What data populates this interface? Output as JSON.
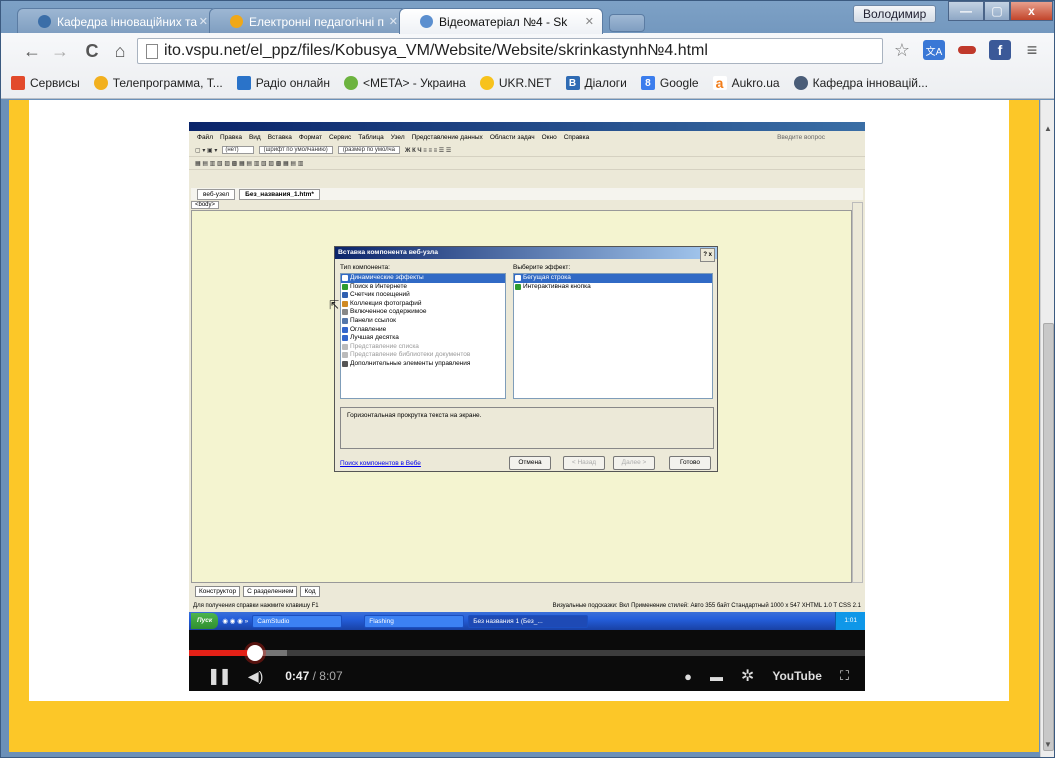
{
  "window": {
    "user_label": "Володимир",
    "minimize_glyph": "—",
    "maximize_glyph": "▢",
    "close_glyph": "x"
  },
  "tabs": [
    {
      "label": "Кафедра інноваційних та",
      "icon": "globe-icon",
      "active": false
    },
    {
      "label": "Електронні педагогічні п",
      "icon": "globe-icon",
      "active": false
    },
    {
      "label": "Відеоматеріал №4 - Sk",
      "icon": "video-icon",
      "active": true
    }
  ],
  "toolbar": {
    "url": "ito.vspu.net/el_ppz/files/Kobusya_VM/Website/Website/skrinkastynh№4.html",
    "back_glyph": "←",
    "forward_glyph": "→",
    "reload_glyph": "C",
    "home_glyph": "⌂",
    "star_glyph": "☆",
    "menu_glyph": "≡"
  },
  "bookmarks": [
    {
      "label": "Сервисы",
      "color": "#e24a2b"
    },
    {
      "label": "Телепрограмма, Т...",
      "color": "#f2b01e"
    },
    {
      "label": "Радіо онлайн",
      "color": "#2a73c9"
    },
    {
      "label": "<META> - Украина",
      "color": "#6cb33f"
    },
    {
      "label": "UKR.NET",
      "color": "#f7c21c"
    },
    {
      "label": "Діалоги",
      "color": "#2f6bb4"
    },
    {
      "label": "Google",
      "color": "#3b7ded"
    },
    {
      "label": "Aukro.ua",
      "color": "#f27d1a"
    },
    {
      "label": "Кафедра інновацій...",
      "color": "#4a5d78"
    }
  ],
  "frontpage": {
    "menu": [
      "Файл",
      "Правка",
      "Вид",
      "Вставка",
      "Формат",
      "Сервис",
      "Таблица",
      "Узел",
      "Представление данных",
      "Области задач",
      "Окно",
      "Справка"
    ],
    "help_hint": "Введите вопрос",
    "style_box": "(нет)",
    "font_box": "(шрифт по умолчанию)",
    "size_box": "(размер по умолча",
    "tab_site": "веб-узел",
    "tab_file": "Без_названия_1.htm*",
    "tag": "<body>",
    "views": [
      "Конструктор",
      "С разделением",
      "Код"
    ],
    "status_left": "Для получения справки нажмите клавишу F1",
    "status_right": "Визуальные подсказки: Вкл  Применение стилей: Авто  355 байт  Стандартный  1000 x 547  XHTML 1.0 T  CSS 2.1"
  },
  "dialog": {
    "title": "Вставка компонента веб-узла",
    "help_buttons": "? x",
    "type_label": "Тип компонента:",
    "effect_label": "Выберите эффект:",
    "types": [
      {
        "label": "Динамические эффекты",
        "state": "selected",
        "color": "#3a7bd5"
      },
      {
        "label": "Поиск в Интернете",
        "state": "normal",
        "color": "#2f9c2f"
      },
      {
        "label": "Счетчик посещений",
        "state": "normal",
        "color": "#2f5fb0"
      },
      {
        "label": "Коллекция фотографий",
        "state": "normal",
        "color": "#d08a23"
      },
      {
        "label": "Включенное содержимое",
        "state": "normal",
        "color": "#888888"
      },
      {
        "label": "Панели ссылок",
        "state": "normal",
        "color": "#5577aa"
      },
      {
        "label": "Оглавление",
        "state": "normal",
        "color": "#3366cc"
      },
      {
        "label": "Лучшая десятка",
        "state": "normal",
        "color": "#3366cc"
      },
      {
        "label": "Представление списка",
        "state": "disabled",
        "color": "#aaaaaa"
      },
      {
        "label": "Представление библиотеки документов",
        "state": "disabled",
        "color": "#aaaaaa"
      },
      {
        "label": "Дополнительные элементы управления",
        "state": "normal",
        "color": "#555555"
      }
    ],
    "effects": [
      {
        "label": "Бегущая строка",
        "state": "selected",
        "color": "#3a7bd5"
      },
      {
        "label": "Интерактивная кнопка",
        "state": "normal",
        "color": "#2f9c2f"
      }
    ],
    "description": "Горизонтальная прокрутка текста на экране.",
    "link": "Поиск компонентов в Вебе",
    "cancel": "Отмена",
    "back": "< Назад",
    "next": "Далее >",
    "finish": "Готово"
  },
  "taskbar": {
    "start": "Пуск",
    "items": [
      "CamStudio",
      "Flashing",
      "Без названия 1 (Без_..."
    ],
    "clock": "1:01"
  },
  "video": {
    "current_time": "0:47",
    "duration": "/ 8:07",
    "played_fraction": 0.097,
    "buffered_fraction": 0.145,
    "youtube_label": "YouTube"
  }
}
